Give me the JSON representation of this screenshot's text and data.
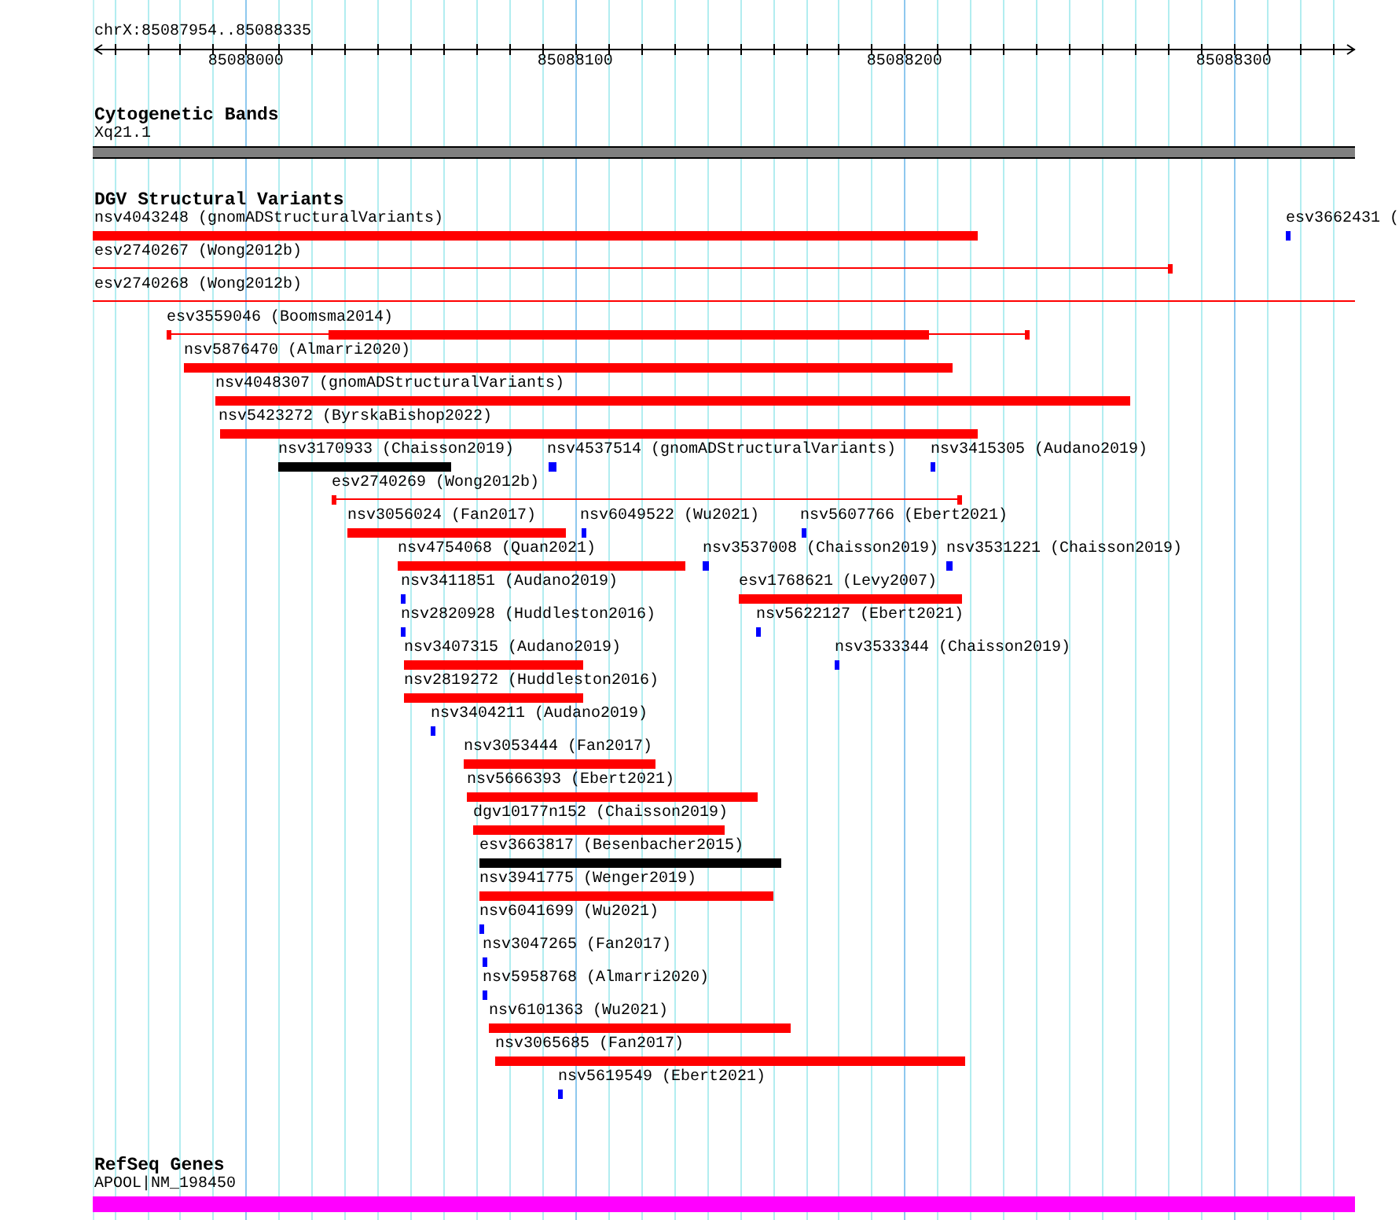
{
  "ruler": {
    "location": "chrX:85087954..85088335",
    "tick_labels": [
      "85088000",
      "85088100",
      "85088200",
      "85088300"
    ]
  },
  "tracks": [
    {
      "kind": "cytobands",
      "title": "Cytogenetic Bands",
      "features": [
        {
          "label": "Xq21.1",
          "color": "#808080"
        }
      ]
    },
    {
      "kind": "variants",
      "title": "DGV Structural Variants",
      "rows": [
        {
          "features": [
            {
              "label": "nsv4043248 (gnomADStructuralVariants)",
              "kind": "block",
              "color": "#ff0000"
            },
            {
              "label": "esv3662431 (",
              "kind": "block",
              "color": "#0000ff"
            }
          ]
        },
        {
          "features": [
            {
              "label": "esv2740267 (Wong2012b)",
              "kind": "span",
              "color": "#ff0000"
            }
          ]
        },
        {
          "features": [
            {
              "label": "esv2740268 (Wong2012b)",
              "kind": "span",
              "color": "#ff0000"
            }
          ]
        },
        {
          "features": [
            {
              "label": "esv3559046 (Boomsma2014)",
              "kind": "span",
              "color": "#ff0000"
            }
          ]
        },
        {
          "features": [
            {
              "label": "nsv5876470 (Almarri2020)",
              "kind": "block",
              "color": "#ff0000"
            }
          ]
        },
        {
          "features": [
            {
              "label": "nsv4048307 (gnomADStructuralVariants)",
              "kind": "block",
              "color": "#ff0000"
            }
          ]
        },
        {
          "features": [
            {
              "label": "nsv5423272 (ByrskaBishop2022)",
              "kind": "block",
              "color": "#ff0000"
            }
          ]
        },
        {
          "features": [
            {
              "label": "nsv3170933 (Chaisson2019)",
              "kind": "block",
              "color": "#000000"
            },
            {
              "label": "nsv4537514 (gnomADStructuralVariants)",
              "kind": "block",
              "color": "#0000ff"
            },
            {
              "label": "nsv3415305 (Audano2019)",
              "kind": "block",
              "color": "#0000ff"
            }
          ]
        },
        {
          "features": [
            {
              "label": "esv2740269 (Wong2012b)",
              "kind": "span",
              "color": "#ff0000"
            }
          ]
        },
        {
          "features": [
            {
              "label": "nsv3056024 (Fan2017)",
              "kind": "block",
              "color": "#ff0000"
            },
            {
              "label": "nsv6049522 (Wu2021)",
              "kind": "block",
              "color": "#0000ff"
            },
            {
              "label": "nsv5607766 (Ebert2021)",
              "kind": "block",
              "color": "#0000ff"
            }
          ]
        },
        {
          "features": [
            {
              "label": "nsv4754068 (Quan2021)",
              "kind": "block",
              "color": "#ff0000"
            },
            {
              "label": "nsv3537008 (Chaisson2019)",
              "kind": "block",
              "color": "#0000ff"
            },
            {
              "label": "nsv3531221 (Chaisson2019)",
              "kind": "block",
              "color": "#0000ff"
            }
          ]
        },
        {
          "features": [
            {
              "label": "nsv3411851 (Audano2019)",
              "kind": "block",
              "color": "#0000ff"
            },
            {
              "label": "esv1768621 (Levy2007)",
              "kind": "block",
              "color": "#ff0000"
            }
          ]
        },
        {
          "features": [
            {
              "label": "nsv2820928 (Huddleston2016)",
              "kind": "block",
              "color": "#0000ff"
            },
            {
              "label": "nsv5622127 (Ebert2021)",
              "kind": "block",
              "color": "#0000ff"
            }
          ]
        },
        {
          "features": [
            {
              "label": "nsv3407315 (Audano2019)",
              "kind": "block",
              "color": "#ff0000"
            },
            {
              "label": "nsv3533344 (Chaisson2019)",
              "kind": "block",
              "color": "#0000ff"
            }
          ]
        },
        {
          "features": [
            {
              "label": "nsv2819272 (Huddleston2016)",
              "kind": "block",
              "color": "#ff0000"
            }
          ]
        },
        {
          "features": [
            {
              "label": "nsv3404211 (Audano2019)",
              "kind": "block",
              "color": "#0000ff"
            }
          ]
        },
        {
          "features": [
            {
              "label": "nsv3053444 (Fan2017)",
              "kind": "block",
              "color": "#ff0000"
            }
          ]
        },
        {
          "features": [
            {
              "label": "nsv5666393 (Ebert2021)",
              "kind": "block",
              "color": "#ff0000"
            }
          ]
        },
        {
          "features": [
            {
              "label": "dgv10177n152 (Chaisson2019)",
              "kind": "block",
              "color": "#ff0000"
            }
          ]
        },
        {
          "features": [
            {
              "label": "esv3663817 (Besenbacher2015)",
              "kind": "block",
              "color": "#000000"
            }
          ]
        },
        {
          "features": [
            {
              "label": "nsv3941775 (Wenger2019)",
              "kind": "block",
              "color": "#ff0000"
            }
          ]
        },
        {
          "features": [
            {
              "label": "nsv6041699 (Wu2021)",
              "kind": "block",
              "color": "#0000ff"
            }
          ]
        },
        {
          "features": [
            {
              "label": "nsv3047265 (Fan2017)",
              "kind": "block",
              "color": "#0000ff"
            }
          ]
        },
        {
          "features": [
            {
              "label": "nsv5958768 (Almarri2020)",
              "kind": "block",
              "color": "#0000ff"
            }
          ]
        },
        {
          "features": [
            {
              "label": "nsv6101363 (Wu2021)",
              "kind": "block",
              "color": "#ff0000"
            }
          ]
        },
        {
          "features": [
            {
              "label": "nsv3065685 (Fan2017)",
              "kind": "block",
              "color": "#ff0000"
            }
          ]
        },
        {
          "features": [
            {
              "label": "nsv5619549 (Ebert2021)",
              "kind": "block",
              "color": "#0000ff"
            }
          ]
        }
      ]
    },
    {
      "kind": "genes",
      "title": "RefSeq Genes",
      "features": [
        {
          "label": "APOOL|NM_198450",
          "color": "#ff00ff"
        }
      ]
    }
  ]
}
